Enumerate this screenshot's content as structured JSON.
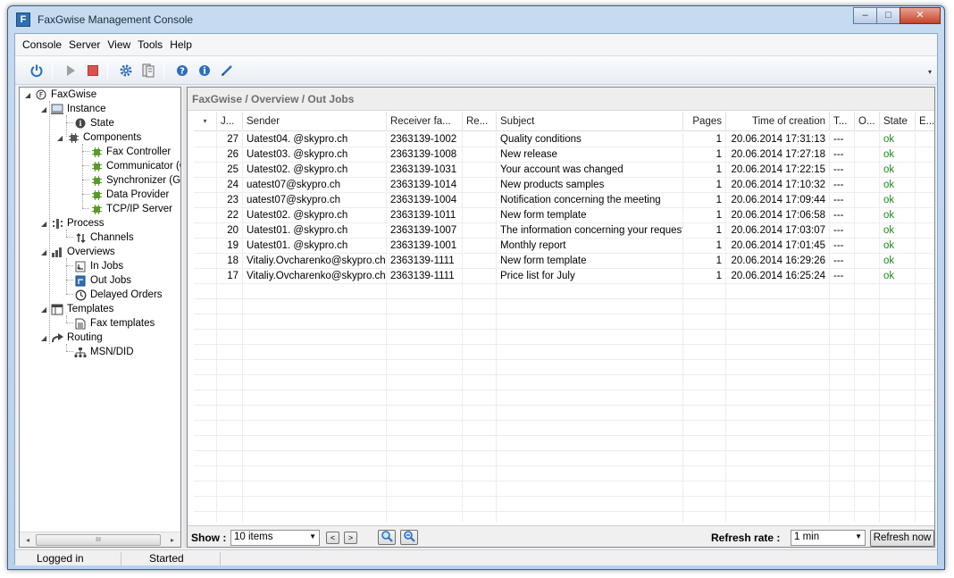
{
  "window": {
    "title": "FaxGwise Management Console",
    "app_icon_letter": "F",
    "minimize": "‒",
    "maximize": "□",
    "close": "✕"
  },
  "menu": [
    "Console",
    "Server",
    "View",
    "Tools",
    "Help"
  ],
  "toolbar": {
    "icons": [
      "power-icon",
      "play-icon",
      "stop-icon",
      "settings-gear-icon",
      "server-icon",
      "help-icon",
      "info-icon",
      "edit-pencil-icon"
    ],
    "more": "▾"
  },
  "tree": {
    "root": "FaxGwise",
    "instance": "Instance",
    "state": "State",
    "components": "Components",
    "fax_controller": "Fax Controller",
    "communicator": "Communicator (G",
    "synchronizer": "Synchronizer (Gr",
    "data_provider": "Data Provider",
    "tcpip_server": "TCP/IP Server",
    "process": "Process",
    "channels": "Channels",
    "overviews": "Overviews",
    "in_jobs": "In Jobs",
    "out_jobs": "Out Jobs",
    "delayed_orders": "Delayed Orders",
    "templates": "Templates",
    "fax_templates": "Fax templates",
    "routing": "Routing",
    "msn_did": "MSN/DID",
    "scroll_left": "◂",
    "scroll_right": "▸",
    "scroll_grip": "III"
  },
  "breadcrumb": "FaxGwise / Overview / Out Jobs",
  "grid": {
    "sort_indicator": "▾",
    "columns": [
      "J...",
      "Sender",
      "Receiver fa...",
      "Re...",
      "Subject",
      "Pages",
      "Time of creation",
      "T...",
      "O...",
      "State",
      "E..."
    ],
    "rows": [
      [
        "27",
        "Uatest04. @skypro.ch",
        "2363139-1002",
        "",
        "Quality conditions",
        "1",
        "20.06.2014 17:31:13",
        "---",
        "",
        "ok",
        ""
      ],
      [
        "26",
        "Uatest03. @skypro.ch",
        "2363139-1008",
        "",
        "New release",
        "1",
        "20.06.2014 17:27:18",
        "---",
        "",
        "ok",
        ""
      ],
      [
        "25",
        "Uatest02. @skypro.ch",
        "2363139-1031",
        "",
        "Your account was changed",
        "1",
        "20.06.2014 17:22:15",
        "---",
        "",
        "ok",
        ""
      ],
      [
        "24",
        "uatest07@skypro.ch",
        "2363139-1014",
        "",
        "New products samples",
        "1",
        "20.06.2014 17:10:32",
        "---",
        "",
        "ok",
        ""
      ],
      [
        "23",
        "uatest07@skypro.ch",
        "2363139-1004",
        "",
        "Notification concerning the meeting",
        "1",
        "20.06.2014 17:09:44",
        "---",
        "",
        "ok",
        ""
      ],
      [
        "22",
        "Uatest02. @skypro.ch",
        "2363139-1011",
        "",
        "New form template",
        "1",
        "20.06.2014 17:06:58",
        "---",
        "",
        "ok",
        ""
      ],
      [
        "20",
        "Uatest01. @skypro.ch",
        "2363139-1007",
        "",
        "The information concerning your request",
        "1",
        "20.06.2014 17:03:07",
        "---",
        "",
        "ok",
        ""
      ],
      [
        "19",
        "Uatest01. @skypro.ch",
        "2363139-1001",
        "",
        "Monthly report",
        "1",
        "20.06.2014 17:01:45",
        "---",
        "",
        "ok",
        ""
      ],
      [
        "18",
        "Vitaliy.Ovcharenko@skypro.ch",
        "2363139-1111",
        "",
        "New form template",
        "1",
        "20.06.2014 16:29:26",
        "---",
        "",
        "ok",
        ""
      ],
      [
        "17",
        "Vitaliy.Ovcharenko@skypro.ch",
        "2363139-1111",
        "",
        "Price list for July",
        "1",
        "20.06.2014 16:25:24",
        "---",
        "",
        "ok",
        ""
      ]
    ]
  },
  "bottom": {
    "show_label": "Show :",
    "show_value": "10 items",
    "prev": "<",
    "next": ">",
    "refresh_label": "Refresh rate :",
    "refresh_value": "1 min",
    "refresh_now": "Refresh now",
    "combo_arrow": "▼"
  },
  "status": {
    "left": "Logged in",
    "right": "Started"
  },
  "colors": {
    "ok": "#1a8a1a",
    "accent": "#2f6fb5"
  }
}
